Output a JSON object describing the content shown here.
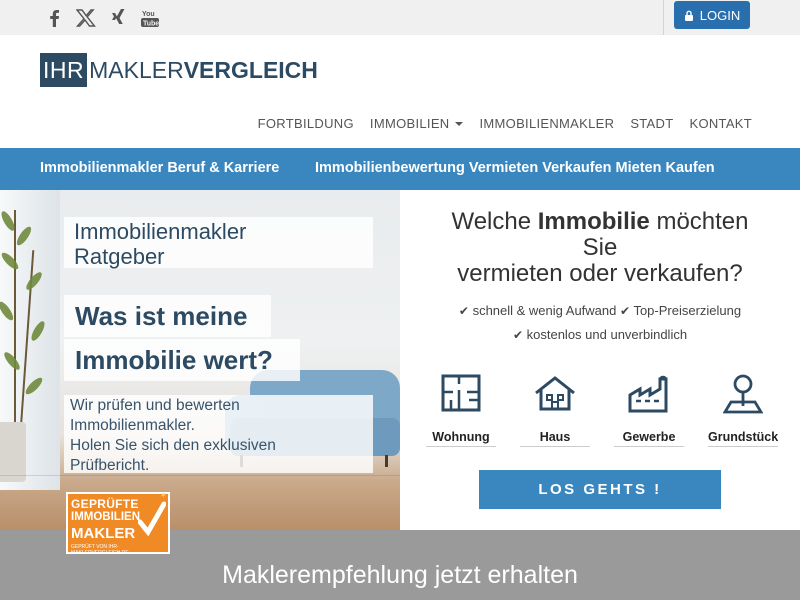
{
  "topbar": {
    "social": [
      "facebook-icon",
      "x-twitter-icon",
      "xing-icon",
      "youtube-icon"
    ],
    "login_label": "LOGIN"
  },
  "logo": {
    "part1": "IHR",
    "part2": "MAKLER",
    "part3": "VERGLEICH"
  },
  "nav": {
    "items": [
      {
        "label": "FORTBILDUNG"
      },
      {
        "label": "IMMOBILIEN",
        "dropdown": true
      },
      {
        "label": "IMMOBILIENMAKLER"
      },
      {
        "label": "STADT"
      },
      {
        "label": "KONTAKT"
      }
    ]
  },
  "subnav": {
    "left": "Immobilienmakler Beruf & Karriere",
    "right": "Immobilienbewertung Vermieten Verkaufen Mieten Kaufen"
  },
  "hero": {
    "box1_line1": "Immobilienmakler",
    "box1_line2": "Ratgeber",
    "box2": "Was ist meine",
    "box3": "Immobilie wert?",
    "box4_line1": "Wir prüfen und bewerten",
    "box4_line2": "Immobilienmakler.",
    "box4_line3": "Holen Sie sich den exklusiven",
    "box4_line4": "Prüfbericht.",
    "badge": {
      "line1": "GEPRÜFTE",
      "line2": "IMMOBILIEN",
      "line3": "MAKLER",
      "line4": "GEPRÜFT VON IHR-MAKLERVERGLEICH.DE"
    }
  },
  "panel": {
    "q_part1": "Welche ",
    "q_bold": "Immobilie",
    "q_part2": " möchten",
    "q_line2": "Sie",
    "q_line3": "vermieten oder verkaufen?",
    "feat1": "schnell & wenig Aufwand",
    "feat2": "Top-Preiserzielung",
    "feat3": "kostenlos und unverbindlich",
    "types": [
      {
        "label": "Wohnung",
        "icon": "floorplan-icon"
      },
      {
        "label": "Haus",
        "icon": "house-icon"
      },
      {
        "label": "Gewerbe",
        "icon": "factory-icon"
      },
      {
        "label": "Grundstück",
        "icon": "land-plot-icon"
      }
    ],
    "cta": "LOS GEHTS !"
  },
  "band": {
    "title": "Maklerempfehlung jetzt erhalten"
  },
  "colors": {
    "brand_dark": "#2d4a63",
    "accent_blue": "#3a87c0",
    "login_blue": "#2a6fad",
    "badge_orange": "#f08a24",
    "band_grey": "#9a9a9a"
  }
}
